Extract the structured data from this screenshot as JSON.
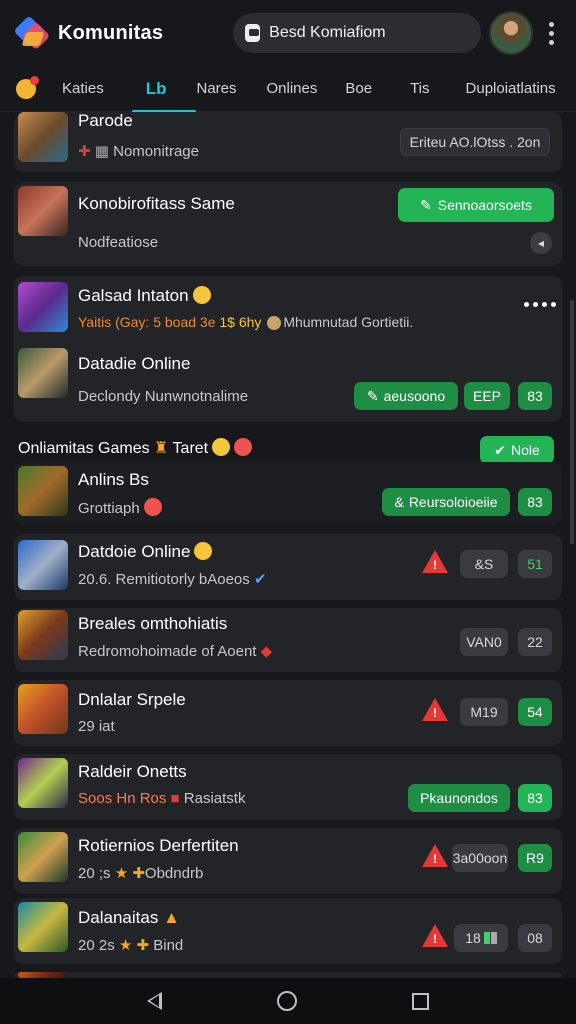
{
  "header": {
    "app_title": "Komunitas",
    "search_placeholder": "Besd Komiafiom"
  },
  "tabs": [
    {
      "label": "Katies"
    },
    {
      "label": "Nares"
    },
    {
      "label": "Onlines"
    },
    {
      "label": "Boe"
    },
    {
      "label": "Tis"
    },
    {
      "label": "Duploiatlatins"
    }
  ],
  "tab_icon_text": "Lb",
  "items": [
    {
      "title": "Parode",
      "sub": "Nomonitrage",
      "pill": "Eriteu AO.lOtss . 2on"
    },
    {
      "title": "Konobirofitass Same",
      "sub": "Nodfeatiose",
      "button": "Sennoaorsoets",
      "small": "◂"
    },
    {
      "title": "Galsad Intaton",
      "sub_a": "Yaitis (Gay: 5 boad 3e",
      "sub_b": "1$ 6hy",
      "sub_c": "Mhumnutad Gortietii."
    },
    {
      "title": "Datadie Online",
      "sub": "Declondy Nunwnotnalime",
      "button": "aeusoono",
      "pill": "EEP",
      "count": "83"
    },
    {
      "section": "Onliamitas Games",
      "section_tail": "Taret",
      "button": "Nole"
    },
    {
      "title": "Anlins Bs",
      "sub": "Grottiaph",
      "button": "Reursoloioeiie",
      "count": "83"
    },
    {
      "title": "Datdoie Online",
      "sub": "20.6.  Remitiotorly bAoeos",
      "pill": "&S",
      "count": "51"
    },
    {
      "title": "Breales omthohiatis",
      "sub": "Redromohoimade of Aoent",
      "pill": "VAN0",
      "count": "22"
    },
    {
      "title": "Dnlalar Srpele",
      "sub": "29 iat",
      "pill": "M19",
      "count": "54"
    },
    {
      "title": "Raldeir Onetts",
      "sub": "Soos Hn Ros",
      "sub_b": "Rasiatstk",
      "button": "Pkaunondos",
      "count": "83"
    },
    {
      "title": "Rotiernios Derfertiten",
      "sub": "20 ;s",
      "sub_b": "Obdndrb",
      "pill": "3a00oon",
      "count": "R9"
    },
    {
      "title": "Dalanaitas",
      "sub": "20 2s",
      "sub_b": "Bind",
      "pill": "18",
      "count": "08"
    }
  ]
}
